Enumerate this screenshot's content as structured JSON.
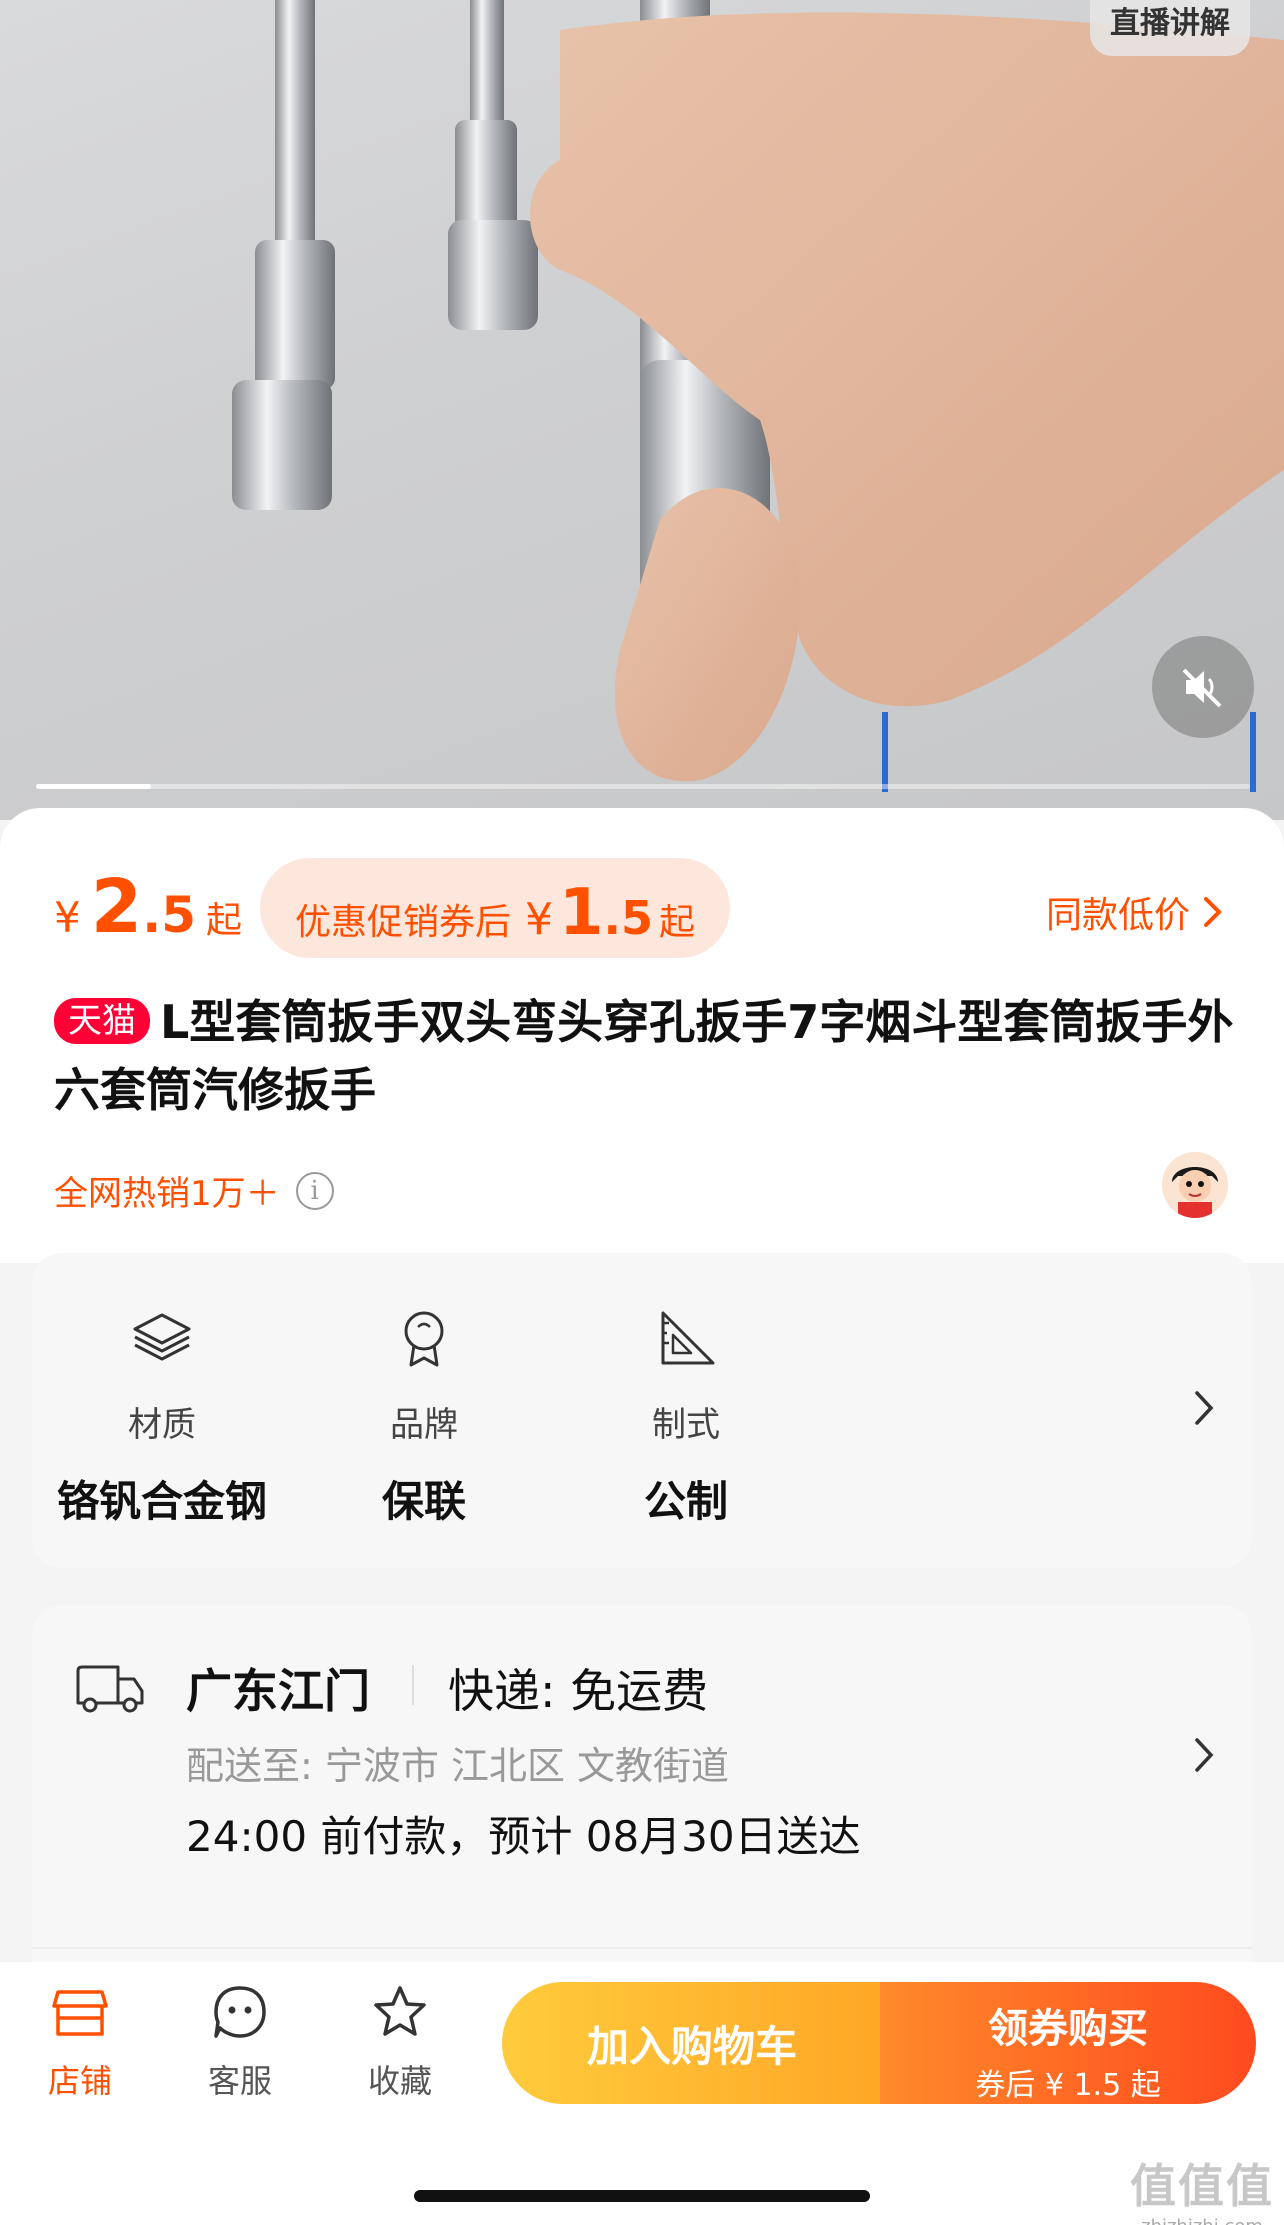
{
  "media": {
    "live_badge": "直播讲解",
    "progress_fraction": 0.095
  },
  "price": {
    "yen": "¥",
    "int": "2",
    "dec": ".5",
    "qi": "起"
  },
  "coupon": {
    "text": "优惠促销券后",
    "yen": "¥",
    "int": "1",
    "dec": ".5",
    "qi": "起"
  },
  "same_low_price": "同款低价",
  "tmall_badge": "天猫",
  "title": "L型套筒扳手双头弯头穿孔扳手7字烟斗型套筒扳手外六套筒汽修扳手",
  "hot_sales": "全网热销1万＋",
  "attributes": [
    {
      "label": "材质",
      "value": "铬钒合金钢",
      "icon": "layers-icon"
    },
    {
      "label": "品牌",
      "value": "保联",
      "icon": "award-icon"
    },
    {
      "label": "制式",
      "value": "公制",
      "icon": "set-square-icon"
    }
  ],
  "delivery": {
    "origin": "广东江门",
    "shipping": "快递: 免运费",
    "to": "配送至: 宁波市 江北区 文教街道",
    "eta": "24:00 前付款，预计 08月30日送达"
  },
  "bottom_bar": {
    "tabs": [
      {
        "label": "店铺",
        "icon": "store-icon"
      },
      {
        "label": "客服",
        "icon": "chat-face-icon"
      },
      {
        "label": "收藏",
        "icon": "star-icon"
      }
    ],
    "cart_button": "加入购物车",
    "buy_button": "领券购买",
    "buy_sub": "券后 ¥ 1.5 起"
  },
  "watermark": {
    "main": "值值值",
    "sub": "zhizhizhi.com"
  },
  "colors": {
    "accent": "#ff5000",
    "tmall": "#ff0036"
  }
}
